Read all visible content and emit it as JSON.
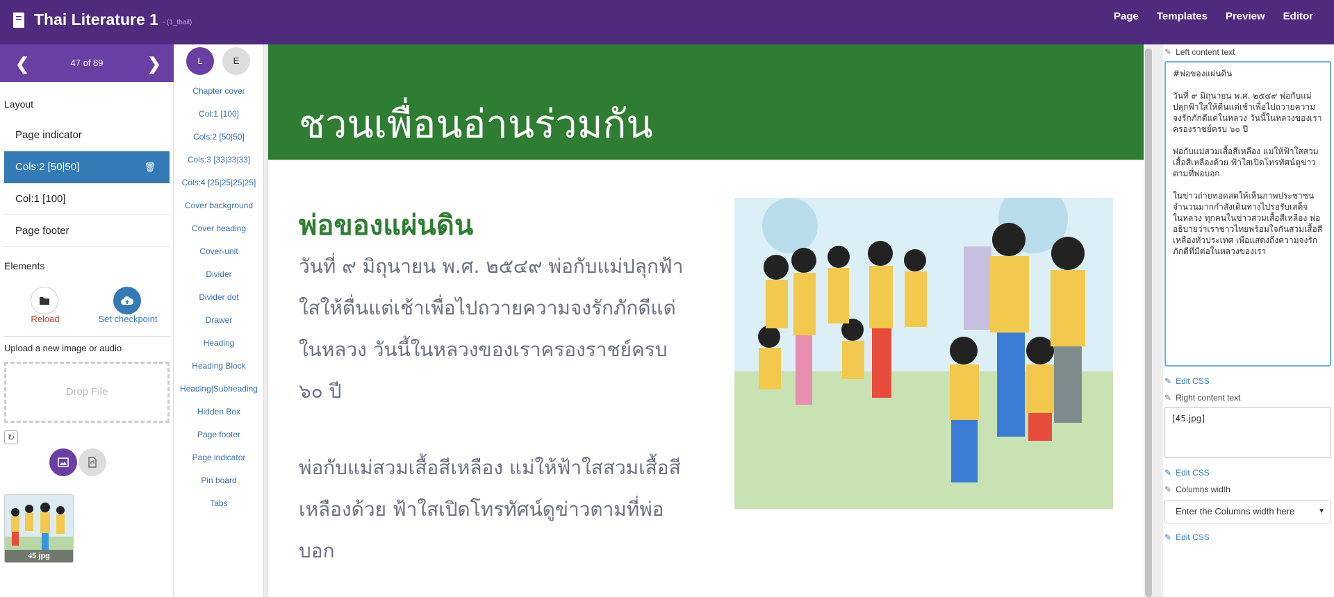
{
  "app": {
    "title": "Thai Literature 1",
    "code": "- (1_thail)",
    "nav": [
      "Page",
      "Templates",
      "Preview",
      "Editor"
    ]
  },
  "pager": {
    "current": "47 of 89"
  },
  "layout": {
    "label": "Layout",
    "items": [
      "Page indicator",
      "Cols:2 [50|50]",
      "Col:1 [100]",
      "Page footer"
    ],
    "active_index": 1
  },
  "elements": {
    "label": "Elements",
    "reload": "Reload",
    "checkpoint": "Set checkpoint",
    "upload_label": "Upload a new image or audio",
    "drop": "Drop File",
    "thumb_name": "45.jpg"
  },
  "components": {
    "lang": [
      "L",
      "E"
    ],
    "items": [
      "Chapter cover",
      "Col:1 [100]",
      "Cols:2 [50|50]",
      "Cols:3 [33|33|33]",
      "Cols:4 [25|25|25|25]",
      "Cover background",
      "Cover heading",
      "Cover-unit",
      "Divider",
      "Divider dot",
      "Drawer",
      "Heading",
      "Heading Block",
      "Heading|Subheading",
      "Hidden Box",
      "Page footer",
      "Page indicator",
      "Pin board",
      "Tabs"
    ]
  },
  "preview": {
    "chapter_title": "ชวนเพื่อนอ่านร่วมกัน",
    "heading": "พ่อของแผ่นดิน",
    "para1": "วันที่ ๙ มิถุนายน พ.ศ. ๒๕๔๙ พ่อกับแม่ปลุกฟ้าใสให้ตื่นแต่เช้าเพื่อไปถวายความจงรักภักดีแด่ในหลวง วันนี้ในหลวงของเราครองราชย์ครบ ๖๐ ปี",
    "para2": "พ่อกับแม่สวมเสื้อสีเหลือง แม่ให้ฟ้าใสสวมเสื้อสีเหลืองด้วย ฟ้าใสเปิดโทรทัศน์ดูข่าวตามที่พ่อบอก"
  },
  "editor": {
    "left_label": "Left content text",
    "left_text": "#พ่อของแผ่นดิน\n\nวันที่ ๙ มิถุนายน พ.ศ. ๒๕๔๙ พ่อกับแม่ปลุกฟ้าใสให้ตื่นแต่เช้าเพื่อไปถวายความจงรักภักดีแด่ในหลวง วันนี้ในหลวงของเราครองราชย์ครบ ๖๐ ปี\n\nพ่อกับแม่สวมเสื้อสีเหลือง แม่ให้ฟ้าใสสวมเสื้อสีเหลืองด้วย ฟ้าใสเปิดโทรทัศน์ดูข่าวตามที่พ่อบอก\n\nในข่าวถ่ายทอดสดให้เห็นภาพประชาชนจำนวนมากกำลังเดินทางไปรอรับเสด็จในหลวง ทุกคนในข่าวสวมเสื้อสีเหลือง พ่ออธิบายว่าเราชาวไทยพร้อมใจกันสวมเสื้อสีเหลืองทั่วประเทศ เพื่อแสดงถึงความจงรักภักดีที่มีต่อในหลวงของเรา",
    "edit_css": "Edit CSS",
    "right_label": "Right content text",
    "right_text": "[45.jpg]",
    "columns_label": "Columns width",
    "columns_placeholder": "Enter the Columns width here"
  },
  "colors": {
    "topbar": "#4f2a7d",
    "pager": "#6a3fa3",
    "active": "#337ab7",
    "chapter": "#2e7d32"
  }
}
